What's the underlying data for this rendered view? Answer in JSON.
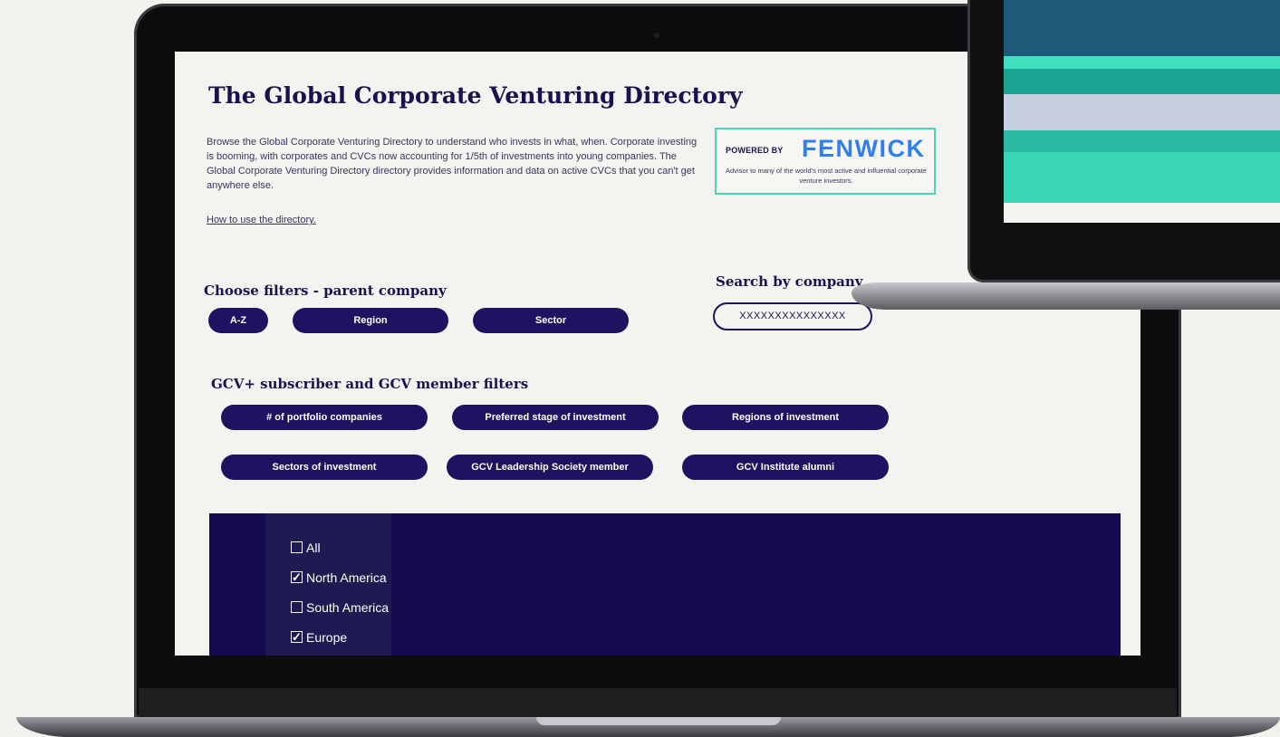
{
  "directory": {
    "title": "The Global Corporate Venturing Directory",
    "intro": "Browse the Global Corporate Venturing Directory to understand who invests in what, when. Corporate investing is booming, with corporates and CVCs  now accounting for 1/5th of investments into young companies. The Global Corporate Venturing Directory directory provides information and data on active CVCs that you can't get anywhere else.",
    "how_to_link": "How to use the directory."
  },
  "sponsor": {
    "powered_by": "POWERED BY",
    "brand": "FENWICK",
    "tagline": "Advisor to many of the world's most active and influential corporate venture investors.",
    "brand_color": "#2f7ff0",
    "border_color": "#4fd1b8"
  },
  "parent_filters": {
    "heading": "Choose filters - parent company",
    "buttons": [
      "A-Z",
      "Region",
      "Sector"
    ]
  },
  "search": {
    "heading": "Search by company",
    "value": "XXXXXXXXXXXXXXX"
  },
  "member_filters": {
    "heading": "GCV+ subscriber and GCV member filters",
    "buttons": [
      "# of portfolio companies",
      "Preferred stage of investment",
      "Regions of investment",
      "Sectors of investment",
      "GCV Leadership Society member",
      "GCV Institute alumni"
    ]
  },
  "region_dropdown": {
    "options": [
      {
        "label": "All",
        "checked": false
      },
      {
        "label": "North America",
        "checked": true
      },
      {
        "label": "South America",
        "checked": false
      },
      {
        "label": "Europe",
        "checked": true
      }
    ]
  },
  "colors": {
    "accent": "#1f1260",
    "panel": "#140a4f",
    "heading": "#1a1150"
  },
  "icons": [
    "checkbox-icon",
    "checkbox-checked-icon",
    "camera-icon"
  ]
}
